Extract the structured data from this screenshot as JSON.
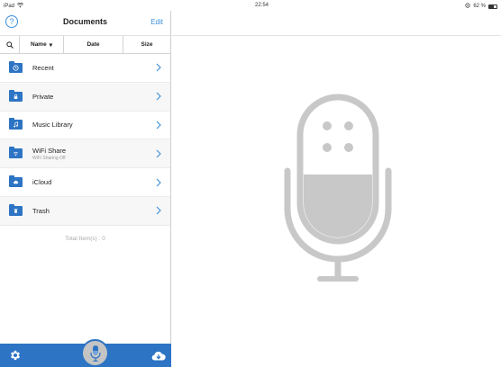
{
  "status_bar": {
    "device": "iPad",
    "wifi_icon": "wifi-icon",
    "time": "22:54",
    "battery_text": "62 %",
    "battery_level": 0.62
  },
  "sidebar": {
    "nav": {
      "help_icon": "help-icon",
      "help_glyph": "?",
      "title": "Documents",
      "edit_label": "Edit"
    },
    "sort": {
      "search_icon": "search-icon",
      "name_label": "Name",
      "name_arrow": "▾",
      "date_label": "Date",
      "size_label": "Size"
    },
    "items": [
      {
        "label": "Recent",
        "sublabel": "",
        "icon": "clock-icon"
      },
      {
        "label": "Private",
        "sublabel": "",
        "icon": "lock-icon"
      },
      {
        "label": "Music Library",
        "sublabel": "",
        "icon": "music-note-icon"
      },
      {
        "label": "WiFi Share",
        "sublabel": "WiFi Sharing Off",
        "icon": "wifi-icon"
      },
      {
        "label": "iCloud",
        "sublabel": "",
        "icon": "cloud-icon"
      },
      {
        "label": "Trash",
        "sublabel": "",
        "icon": "trash-icon"
      }
    ],
    "total_text": "Total Item(s) : 0",
    "tabbar": {
      "settings_icon": "gear-icon",
      "record_icon": "microphone-icon",
      "cloud_icon": "cloud-download-icon"
    }
  },
  "main": {
    "placeholder_icon": "microphone-icon"
  },
  "colors": {
    "accent": "#2d74c4",
    "link": "#3b8fd9",
    "mic_gray": "#c8c8c8"
  }
}
